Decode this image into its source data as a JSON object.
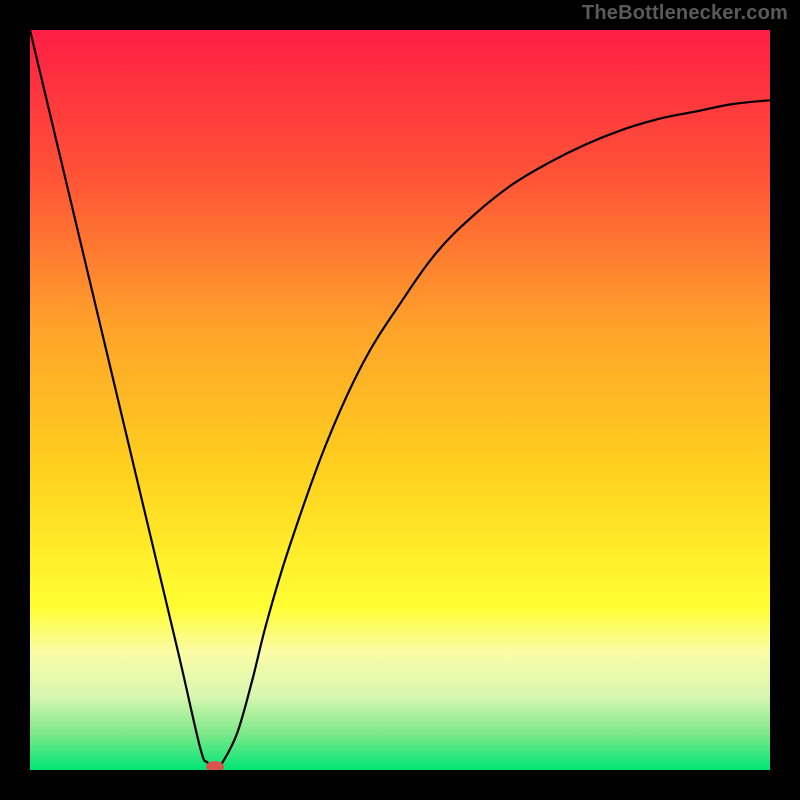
{
  "attribution": "TheBottlenecker.com",
  "chart_data": {
    "type": "line",
    "title": "",
    "xlabel": "",
    "ylabel": "",
    "xlim": [
      0,
      100
    ],
    "ylim": [
      0,
      100
    ],
    "series": [
      {
        "name": "curve",
        "x": [
          0,
          5,
          10,
          15,
          20,
          23,
          24,
          25,
          26,
          28,
          30,
          32,
          35,
          40,
          45,
          50,
          55,
          60,
          65,
          70,
          75,
          80,
          85,
          90,
          95,
          100
        ],
        "values": [
          100,
          79,
          58,
          37,
          16,
          3,
          1,
          0,
          1,
          5,
          12,
          20,
          30,
          44,
          55,
          63,
          70,
          75,
          79,
          82,
          84.5,
          86.5,
          88,
          89,
          90,
          90.5
        ]
      }
    ],
    "gradient_stops": [
      {
        "offset": 0,
        "color": "#ff1e45"
      },
      {
        "offset": 20,
        "color": "#ff5436"
      },
      {
        "offset": 40,
        "color": "#ffa22a"
      },
      {
        "offset": 60,
        "color": "#ffd21e"
      },
      {
        "offset": 78,
        "color": "#ffff33"
      },
      {
        "offset": 84,
        "color": "#fbfca6"
      },
      {
        "offset": 90,
        "color": "#d8f7b0"
      },
      {
        "offset": 95,
        "color": "#7fe88a"
      },
      {
        "offset": 100,
        "color": "#00e676"
      }
    ],
    "marker": {
      "x": 25,
      "y": 0,
      "color": "#d9534f",
      "rx": 9,
      "ry": 6
    }
  }
}
